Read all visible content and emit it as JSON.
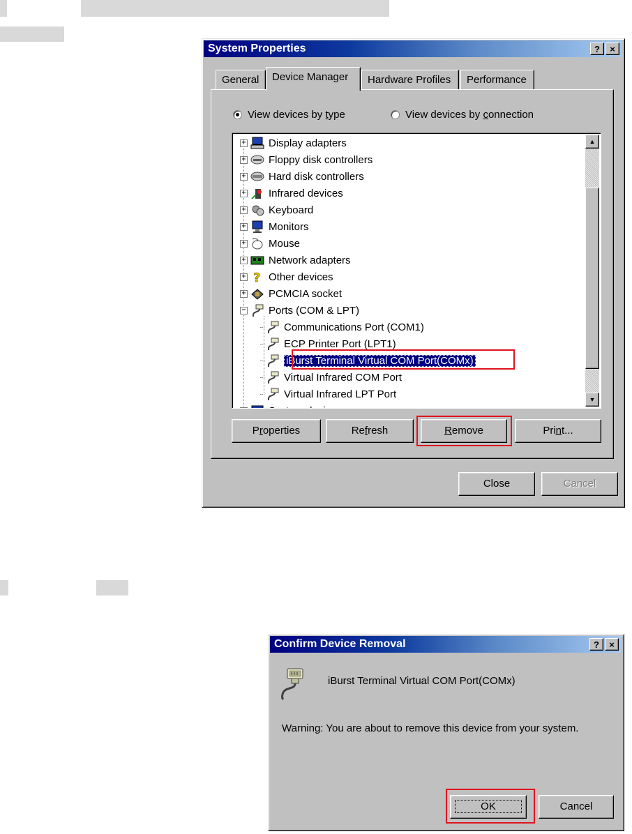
{
  "system_properties": {
    "title": "System Properties",
    "help_button": "?",
    "close_button": "×",
    "tabs": [
      {
        "label": "General"
      },
      {
        "label": "Device Manager"
      },
      {
        "label": "Hardware Profiles"
      },
      {
        "label": "Performance"
      }
    ],
    "radio_by_type": {
      "pre": "View devices by ",
      "key": "t",
      "post": "ype"
    },
    "radio_by_connection": {
      "pre": "View devices by ",
      "key": "c",
      "post": "onnection"
    },
    "tree_items": [
      {
        "label": "Display adapters",
        "icon": "display-adapter-icon"
      },
      {
        "label": "Floppy disk controllers",
        "icon": "floppy-controller-icon"
      },
      {
        "label": "Hard disk controllers",
        "icon": "hard-disk-controller-icon"
      },
      {
        "label": "Infrared devices",
        "icon": "infrared-icon"
      },
      {
        "label": "Keyboard",
        "icon": "keyboard-icon"
      },
      {
        "label": "Monitors",
        "icon": "monitor-icon"
      },
      {
        "label": "Mouse",
        "icon": "mouse-icon"
      },
      {
        "label": "Network adapters",
        "icon": "network-adapter-icon"
      },
      {
        "label": "Other devices",
        "icon": "question-mark-icon"
      },
      {
        "label": "PCMCIA socket",
        "icon": "pcmcia-icon"
      },
      {
        "label": "Ports (COM & LPT)",
        "icon": "port-icon"
      },
      {
        "label": "Communications Port (COM1)",
        "icon": "port-icon"
      },
      {
        "label": "ECP Printer Port (LPT1)",
        "icon": "port-icon"
      },
      {
        "label": "iBurst Terminal Virtual COM Port(COMx)",
        "icon": "port-icon",
        "selected": true
      },
      {
        "label": "Virtual Infrared COM Port",
        "icon": "port-icon"
      },
      {
        "label": "Virtual Infrared LPT Port",
        "icon": "port-icon"
      },
      {
        "label": "System devices",
        "icon": "system-device-icon"
      }
    ],
    "buttons": {
      "properties": {
        "pre": "P",
        "key": "r",
        "post": "operties"
      },
      "refresh": {
        "pre": "Re",
        "key": "f",
        "post": "resh"
      },
      "remove": {
        "pre": "",
        "key": "R",
        "post": "emove"
      },
      "print": {
        "pre": "Pri",
        "key": "n",
        "post": "t..."
      },
      "close": "Close",
      "cancel": "Cancel"
    }
  },
  "confirm_dialog": {
    "title": "Confirm Device Removal",
    "help_button": "?",
    "close_button": "×",
    "device_name": "iBurst Terminal Virtual COM Port(COMx)",
    "warning": "Warning: You are about to remove this device from your system.",
    "ok_label": "OK",
    "cancel_label": "Cancel"
  },
  "colors": {
    "highlight": "#e0141e",
    "selection": "#000080",
    "face": "#c0c0c0"
  }
}
